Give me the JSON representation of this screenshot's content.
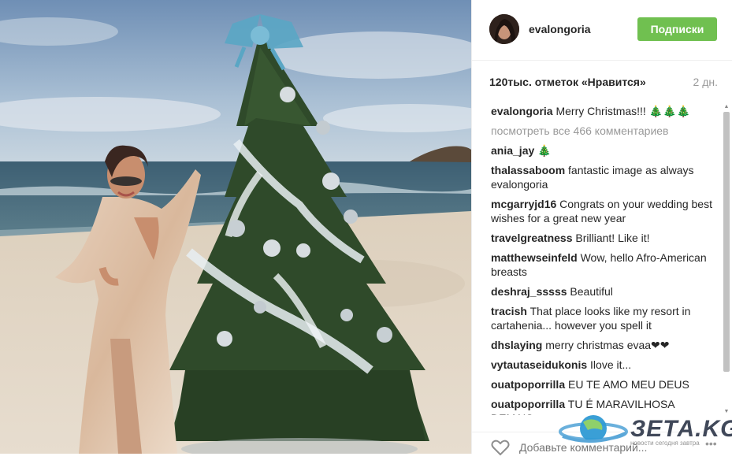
{
  "header": {
    "username": "evalongoria",
    "follow_label": "Подписки"
  },
  "stats": {
    "likes": "120тыс. отметок «Нравится»",
    "age": "2 дн."
  },
  "caption": {
    "user": "evalongoria",
    "text": "Merry Christmas!!! 🎄🎄🎄"
  },
  "view_all": "посмотреть все 466 комментариев",
  "comments": [
    {
      "user": "ania_jay",
      "text": "🎄"
    },
    {
      "user": "thalassaboom",
      "text": "fantastic image as always evalongoria"
    },
    {
      "user": "mcgarryjd16",
      "text": "Congrats on your wedding best wishes for a great new year"
    },
    {
      "user": "travelgreatness",
      "text": "Brilliant! Like it!"
    },
    {
      "user": "matthewseinfeld",
      "text": "Wow, hello Afro-American breasts"
    },
    {
      "user": "deshraj_sssss",
      "text": "Beautiful"
    },
    {
      "user": "tracish",
      "text": "That place looks like my resort in cartahenia... however you spell it"
    },
    {
      "user": "dhslaying",
      "text": "merry christmas evaa❤❤"
    },
    {
      "user": "vytautaseidukonis",
      "text": "Ilove it..."
    },
    {
      "user": "ouatpoporrilla",
      "text": "EU TE AMO MEU DEUS"
    },
    {
      "user": "ouatpoporrilla",
      "text": "TU É MARAVILHOSA DEMAIS"
    }
  ],
  "add_comment_placeholder": "Добавьте комментарий...",
  "more_label": "•••",
  "watermark": {
    "brand": "ЗЕТА.KG",
    "sub": "новости сегодня завтра"
  },
  "colors": {
    "follow_button": "#70c050",
    "text": "#262626",
    "muted": "#999999"
  }
}
